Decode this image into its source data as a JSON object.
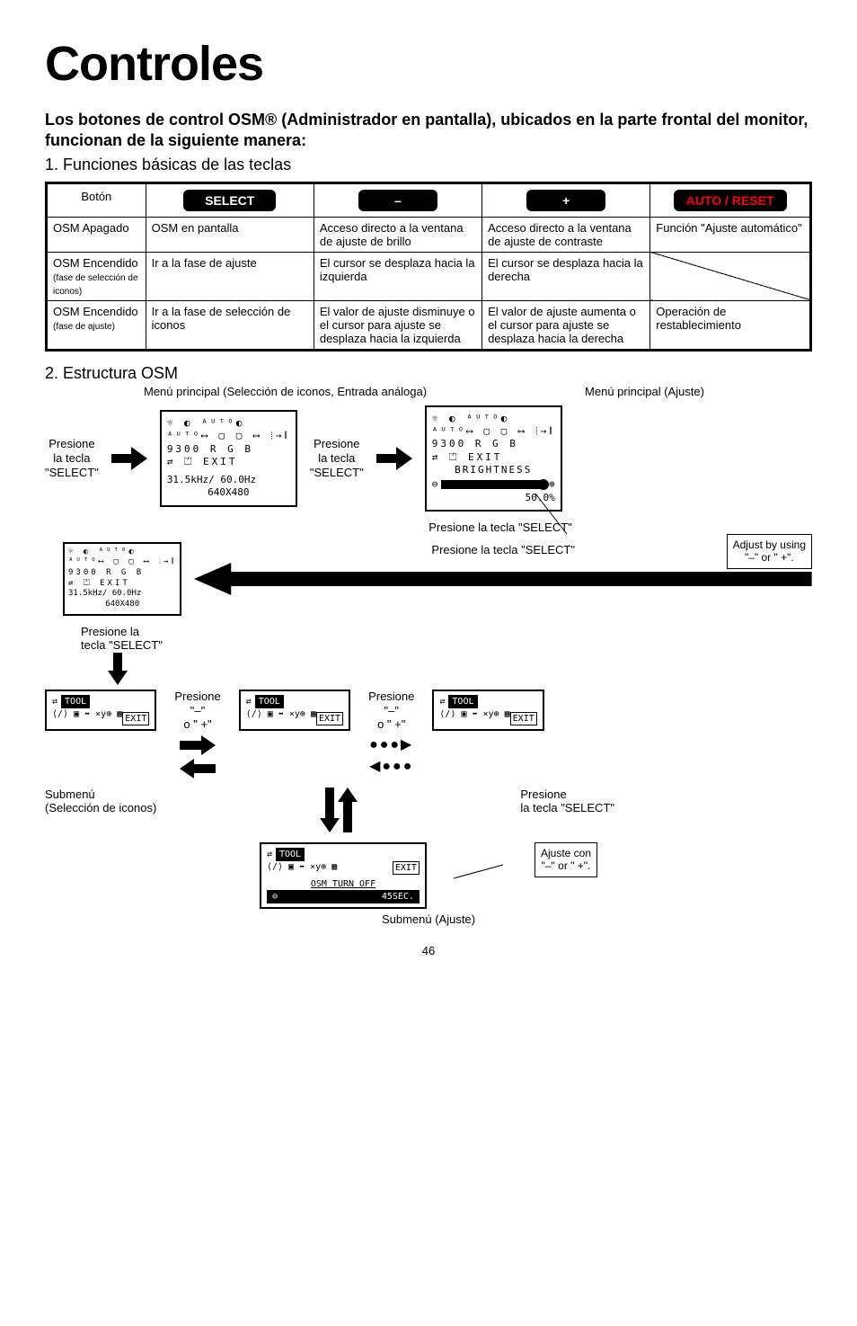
{
  "title": "Controles",
  "intro_bold": "Los botones de control OSM® (Administrador en pantalla), ubicados en la parte frontal del monitor, funcionan de la siguiente manera:",
  "intro_sub": "1. Funciones básicas de las teclas",
  "table": {
    "header": {
      "boton": "Botón",
      "select": "SELECT",
      "minus": "–",
      "plus": "+",
      "auto": "AUTO / RESET"
    },
    "rows": [
      {
        "c1": "OSM Apagado",
        "c2": "OSM en pantalla",
        "c3": "Acceso directo a la ventana de ajuste de brillo",
        "c4": "Acceso directo a la ventana de ajuste de contraste",
        "c5": "Función \"Ajuste automático\""
      },
      {
        "c1a": "OSM Encendido",
        "c1b": "(fase de selección de iconos)",
        "c2": "Ir a la fase de ajuste",
        "c3": "El cursor se desplaza hacia la izquierda",
        "c4": "El cursor se desplaza hacia la derecha",
        "c5": ""
      },
      {
        "c1a": "OSM Encendido",
        "c1b": "(fase de ajuste)",
        "c2": "Ir a la fase de selección de iconos",
        "c3": "El valor de ajuste disminuye o el cursor para ajuste se desplaza hacia la izquierda",
        "c4": "El valor de ajuste aumenta o el cursor para ajuste se desplaza hacia la derecha",
        "c5": "Operación de restablecimiento"
      }
    ]
  },
  "section2": {
    "title": "2. Estructura OSM",
    "menu_left": "Menú principal (Selección de iconos, Entrada análoga)",
    "menu_right": "Menú principal (Ajuste)",
    "press_select": "Presione la tecla \"SELECT\"",
    "press_select_short1": "Presione",
    "press_select_short2": "la tecla",
    "press_select_short3": "\"SELECT\"",
    "press_select_tecla1": "Presione la",
    "press_select_tecla2": "tecla \"SELECT\"",
    "press_minus1": "Presione",
    "press_minus2": "\"–\"",
    "press_minus3": "o \"–\"",
    "press_plus1": "Presione",
    "press_plus2": "\"–\"",
    "press_plus3": "o \" +\"",
    "presione_select_inline": "Presione la tecla \"SELECT\"",
    "submenu_sel": "Submenú",
    "submenu_sel2": "(Selección de iconos)",
    "submenu_ajuste": "Submenú (Ajuste)",
    "adjust_callout1": "Adjust by using",
    "adjust_callout2": "\"–\" or \" +\".",
    "ajuste_callout1": "Ajuste con",
    "ajuste_callout2": "\"–\" or \" +\".",
    "osm1_line1_icons": "☼ ◐ ᴬᵁᵀᴼ◐",
    "osm1_line2_icons": "ᴬᵁᵀᴼ⟷ ▢ ▢ ⟷ ⦙→∥",
    "osm1_line3_icons": "9300 R G B",
    "osm1_line4_icons": "⇄ ⏍       EXIT",
    "osm1_freq": "31.5kHz/ 60.0Hz",
    "osm1_res": "640X480",
    "osm2_brightness": "BRIGHTNESS",
    "osm2_percent": "50.0%",
    "tool_header": "TOOL",
    "tool_icons": "⟨∕⟩ ▣ ⬌ ×y⊕ ▦",
    "tool_exit": "EXIT",
    "osm_turn_off": "OSM TURN OFF",
    "timer_sec": "45SEC.",
    "page": "46"
  }
}
